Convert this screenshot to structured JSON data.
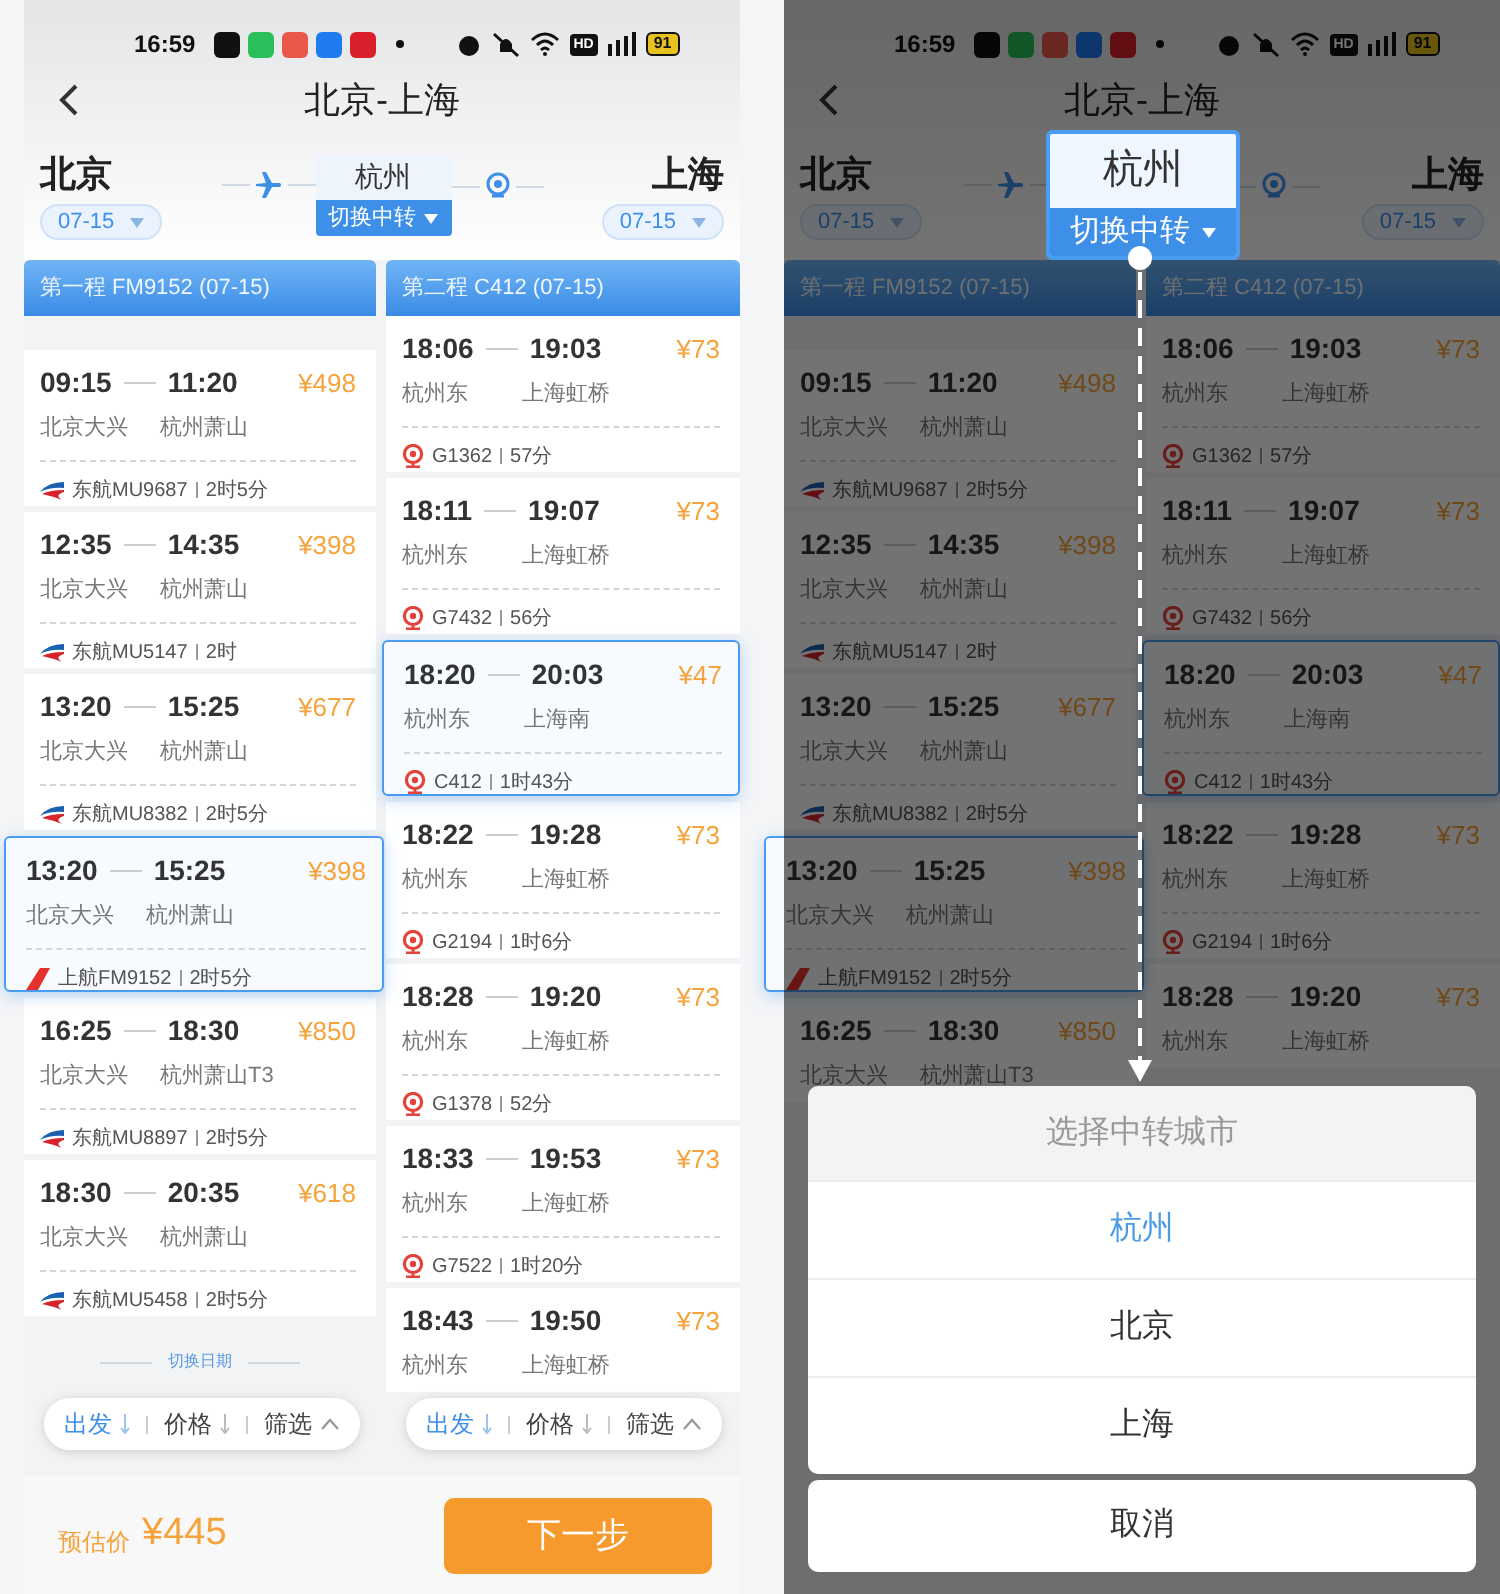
{
  "screens": [
    {
      "status_bar": {
        "time": "16:59",
        "hd": "HD",
        "battery": "91"
      },
      "header": {
        "title": "北京-上海"
      },
      "route": {
        "origin": {
          "city": "北京",
          "date": "07-15"
        },
        "transfer": {
          "city": "杭州",
          "switch_label": "切换中转"
        },
        "destination": {
          "city": "上海",
          "date": "07-15"
        }
      },
      "legs": [
        {
          "header": "第一程 FM9152 (07-15)",
          "kind": "flight",
          "options": [
            {
              "depart": "09:15",
              "arrive": "11:20",
              "price": "¥498",
              "from": "北京大兴",
              "to": "杭州萧山",
              "kind": "swallow",
              "carrier": "东航MU9687",
              "duration": "2时5分",
              "selected": false
            },
            {
              "depart": "12:35",
              "arrive": "14:35",
              "price": "¥398",
              "from": "北京大兴",
              "to": "杭州萧山",
              "kind": "swallow",
              "carrier": "东航MU5147",
              "duration": "2时",
              "selected": false
            },
            {
              "depart": "13:20",
              "arrive": "15:25",
              "price": "¥677",
              "from": "北京大兴",
              "to": "杭州萧山",
              "kind": "swallow",
              "carrier": "东航MU8382",
              "duration": "2时5分",
              "selected": false
            },
            {
              "depart": "13:20",
              "arrive": "15:25",
              "price": "¥398",
              "from": "北京大兴",
              "to": "杭州萧山",
              "kind": "tail",
              "carrier": "上航FM9152",
              "duration": "2时5分",
              "selected": true
            },
            {
              "depart": "16:25",
              "arrive": "18:30",
              "price": "¥850",
              "from": "北京大兴",
              "to": "杭州萧山T3",
              "kind": "swallow",
              "carrier": "东航MU8897",
              "duration": "2时5分",
              "selected": false
            },
            {
              "depart": "18:30",
              "arrive": "20:35",
              "price": "¥618",
              "from": "北京大兴",
              "to": "杭州萧山",
              "kind": "swallow",
              "carrier": "东航MU5458",
              "duration": "2时5分",
              "selected": false
            }
          ]
        },
        {
          "header": "第二程 C412 (07-15)",
          "kind": "train",
          "options": [
            {
              "depart": "18:06",
              "arrive": "19:03",
              "price": "¥73",
              "from": "杭州东",
              "to": "上海虹桥",
              "carrier": "G1362",
              "duration": "57分",
              "selected": false
            },
            {
              "depart": "18:11",
              "arrive": "19:07",
              "price": "¥73",
              "from": "杭州东",
              "to": "上海虹桥",
              "carrier": "G7432",
              "duration": "56分",
              "selected": false
            },
            {
              "depart": "18:20",
              "arrive": "20:03",
              "price": "¥47",
              "from": "杭州东",
              "to": "上海南",
              "carrier": "C412",
              "duration": "1时43分",
              "selected": true
            },
            {
              "depart": "18:22",
              "arrive": "19:28",
              "price": "¥73",
              "from": "杭州东",
              "to": "上海虹桥",
              "carrier": "G2194",
              "duration": "1时6分",
              "selected": false
            },
            {
              "depart": "18:28",
              "arrive": "19:20",
              "price": "¥73",
              "from": "杭州东",
              "to": "上海虹桥",
              "carrier": "G1378",
              "duration": "52分",
              "selected": false
            },
            {
              "depart": "18:33",
              "arrive": "19:53",
              "price": "¥73",
              "from": "杭州东",
              "to": "上海虹桥",
              "carrier": "G7522",
              "duration": "1时20分",
              "selected": false
            },
            {
              "depart": "18:43",
              "arrive": "19:50",
              "price": "¥73",
              "from": "杭州东",
              "to": "上海虹桥",
              "selected": false
            }
          ]
        }
      ],
      "switch_date": "切换日期",
      "sort_bars": [
        {
          "items": [
            {
              "label": "出发",
              "kind": "sort",
              "selected": true
            },
            {
              "label": "价格",
              "kind": "sort",
              "selected": false
            },
            {
              "label": "筛选",
              "kind": "filter",
              "selected": false
            }
          ]
        },
        {
          "items": [
            {
              "label": "出发",
              "kind": "sort",
              "selected": true
            },
            {
              "label": "价格",
              "kind": "sort",
              "selected": false
            },
            {
              "label": "筛选",
              "kind": "filter",
              "selected": false
            }
          ]
        }
      ],
      "footer": {
        "estimate_label": "预估价",
        "estimate": "¥445",
        "next": "下一步"
      }
    },
    {
      "status_bar": {
        "time": "16:59",
        "hd": "HD",
        "battery": "91"
      },
      "header": {
        "title": "北京-上海"
      },
      "route": {
        "origin": {
          "city": "北京",
          "date": "07-15"
        },
        "transfer": {
          "city": "杭州",
          "switch_label": "切换中转"
        },
        "destination": {
          "city": "上海",
          "date": "07-15"
        }
      },
      "legs": [
        {
          "header": "第一程 FM9152 (07-15)",
          "kind": "flight",
          "options": [
            {
              "depart": "09:15",
              "arrive": "11:20",
              "price": "¥498",
              "from": "北京大兴",
              "to": "杭州萧山",
              "kind": "swallow",
              "carrier": "东航MU9687",
              "duration": "2时5分",
              "selected": false
            },
            {
              "depart": "12:35",
              "arrive": "14:35",
              "price": "¥398",
              "from": "北京大兴",
              "to": "杭州萧山",
              "kind": "swallow",
              "carrier": "东航MU5147",
              "duration": "2时",
              "selected": false
            },
            {
              "depart": "13:20",
              "arrive": "15:25",
              "price": "¥677",
              "from": "北京大兴",
              "to": "杭州萧山",
              "kind": "swallow",
              "carrier": "东航MU8382",
              "duration": "2时5分",
              "selected": false
            },
            {
              "depart": "13:20",
              "arrive": "15:25",
              "price": "¥398",
              "from": "北京大兴",
              "to": "杭州萧山",
              "kind": "tail",
              "carrier": "上航FM9152",
              "duration": "2时5分",
              "selected": true
            },
            {
              "depart": "16:25",
              "arrive": "18:30",
              "price": "¥850",
              "from": "北京大兴",
              "to": "杭州萧山T3",
              "selected": false
            }
          ]
        },
        {
          "header": "第二程 C412 (07-15)",
          "kind": "train",
          "options": [
            {
              "depart": "18:06",
              "arrive": "19:03",
              "price": "¥73",
              "from": "杭州东",
              "to": "上海虹桥",
              "carrier": "G1362",
              "duration": "57分",
              "selected": false
            },
            {
              "depart": "18:11",
              "arrive": "19:07",
              "price": "¥73",
              "from": "杭州东",
              "to": "上海虹桥",
              "carrier": "G7432",
              "duration": "56分",
              "selected": false
            },
            {
              "depart": "18:20",
              "arrive": "20:03",
              "price": "¥47",
              "from": "杭州东",
              "to": "上海南",
              "carrier": "C412",
              "duration": "1时43分",
              "selected": true
            },
            {
              "depart": "18:22",
              "arrive": "19:28",
              "price": "¥73",
              "from": "杭州东",
              "to": "上海虹桥",
              "carrier": "G2194",
              "duration": "1时6分",
              "selected": false
            },
            {
              "depart": "18:28",
              "arrive": "19:20",
              "price": "¥73",
              "from": "杭州东",
              "to": "上海虹桥",
              "selected": false
            }
          ]
        }
      ],
      "transfer_picker": {
        "title": "选择中转城市",
        "options": [
          {
            "label": "杭州",
            "selected": true
          },
          {
            "label": "北京",
            "selected": false
          },
          {
            "label": "上海",
            "selected": false
          }
        ],
        "cancel": "取消"
      }
    }
  ]
}
